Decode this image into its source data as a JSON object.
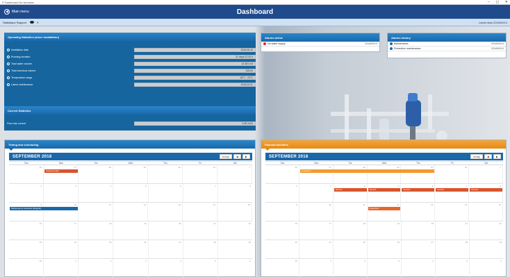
{
  "window": {
    "title": "© Dashboard for windows",
    "controls": [
      "–",
      "◻",
      "✕"
    ]
  },
  "appbar": {
    "menu_label": "Main menu",
    "title": "Dashboard"
  },
  "toolbar": {
    "left_label": "Statistique Rapport",
    "right_label": "Latest data 2018/09/14"
  },
  "operating_panel": {
    "title": "Operating Statistics (since installation)",
    "rows": [
      {
        "icon": "clock-icon",
        "label": "Installation date",
        "value": "2018.08.12"
      },
      {
        "icon": "clock-icon",
        "label": "Running duration",
        "value": "31 days 02:34 h"
      },
      {
        "icon": "drop-icon",
        "label": "Total water volume",
        "value": "12.481 m3"
      },
      {
        "icon": "drop-icon",
        "label": "Total chemical volume",
        "value": "318 ml"
      },
      {
        "icon": "thermometer-icon",
        "label": "Temperature range",
        "value": "18°C - 24°C"
      },
      {
        "icon": "document-icon",
        "label": "Latest maintenance",
        "value": "2018.09.01"
      }
    ]
  },
  "current_panel": {
    "title": "Current Statistics",
    "rows": [
      {
        "label": "Flow rate current",
        "value": "0.85 m3/h"
      }
    ]
  },
  "alerts_active": {
    "title": "Alarms active",
    "items": [
      {
        "color": "#d92a2a",
        "label": "No water supply",
        "date": "2018/09/14"
      }
    ]
  },
  "alerts_past": {
    "title": "Alarms history",
    "items": [
      {
        "color": "#1a68aa",
        "label": "Maintenance",
        "date": "2018/09/14"
      },
      {
        "color": "#1a68aa",
        "label": "Preventive maintenance",
        "date": "2018/09/10"
      }
    ]
  },
  "calendar_left": {
    "title": "Timing and scheduling",
    "month": "SEPTEMBER 2018",
    "today_label": "today",
    "days": [
      "Sun",
      "Mon",
      "Tue",
      "Wed",
      "Thu",
      "Fri",
      "Sat"
    ],
    "weeks": [
      [
        "26",
        "27",
        "28",
        "29",
        "30",
        "31",
        "1"
      ],
      [
        "2",
        "3",
        "4",
        "5",
        "6",
        "7",
        "8"
      ],
      [
        "9",
        "10",
        "11",
        "12",
        "13",
        "14",
        "15"
      ],
      [
        "16",
        "17",
        "18",
        "19",
        "20",
        "21",
        "22"
      ],
      [
        "23",
        "24",
        "25",
        "26",
        "27",
        "28",
        "29"
      ],
      [
        "30",
        "1",
        "2",
        "3",
        "4",
        "5",
        "6"
      ]
    ],
    "events": [
      {
        "label": "Cleaning daily",
        "color": "#d9542a",
        "week": 0,
        "start": 1,
        "span": 1
      },
      {
        "label": "Maintenance schedule (Regular)",
        "color": "#1a68aa",
        "week": 2,
        "start": 0,
        "span": 2
      }
    ]
  },
  "calendar_right": {
    "title": "Planned activities",
    "month": "SEPTEMBER 2018",
    "today_label": "today",
    "days": [
      "Sun",
      "Mon",
      "Tue",
      "Wed",
      "Thu",
      "Fri",
      "Sat"
    ],
    "weeks": [
      [
        "26",
        "27",
        "28",
        "29",
        "30",
        "31",
        "1"
      ],
      [
        "2",
        "3",
        "4",
        "5",
        "6",
        "7",
        "8"
      ],
      [
        "9",
        "10",
        "11",
        "12",
        "13",
        "14",
        "15"
      ],
      [
        "16",
        "17",
        "18",
        "19",
        "20",
        "21",
        "22"
      ],
      [
        "23",
        "24",
        "25",
        "26",
        "27",
        "28",
        "29"
      ],
      [
        "30",
        "1",
        "2",
        "3",
        "4",
        "5",
        "6"
      ]
    ],
    "events": [
      {
        "label": "Inspection",
        "color": "#f39a2e",
        "week": 0,
        "start": 1,
        "span": 4
      },
      {
        "label": "Service",
        "color": "#d9542a",
        "week": 1,
        "start": 2,
        "span": 1
      },
      {
        "label": "Service",
        "color": "#d9542a",
        "week": 1,
        "start": 3,
        "span": 1
      },
      {
        "label": "Service",
        "color": "#d9542a",
        "week": 1,
        "start": 4,
        "span": 1
      },
      {
        "label": "Service",
        "color": "#d9542a",
        "week": 1,
        "start": 5,
        "span": 1
      },
      {
        "label": "Service",
        "color": "#d9542a",
        "week": 1,
        "start": 6,
        "span": 1
      },
      {
        "label": "Inspection",
        "color": "#e9662a",
        "week": 2,
        "start": 3,
        "span": 1
      }
    ]
  }
}
